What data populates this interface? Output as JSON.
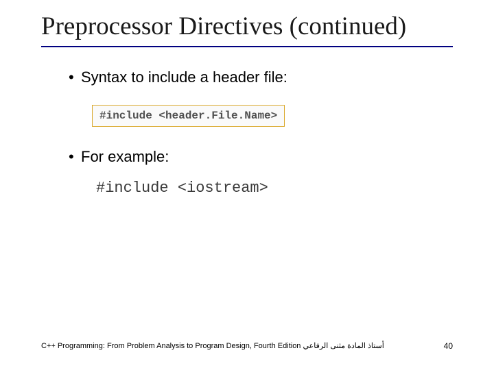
{
  "title": "Preprocessor Directives (continued)",
  "bullets": {
    "b1": "Syntax to include a header file:",
    "b2": "For example:"
  },
  "code_box": "#include <header.File.Name>",
  "example_code": "#include <iostream>",
  "footer": {
    "left_en": "C++ Programming: From Problem Analysis to Program Design, Fourth Edition",
    "left_ar": "أستاذ المادة مثنى الرفاعي",
    "page": "40"
  }
}
